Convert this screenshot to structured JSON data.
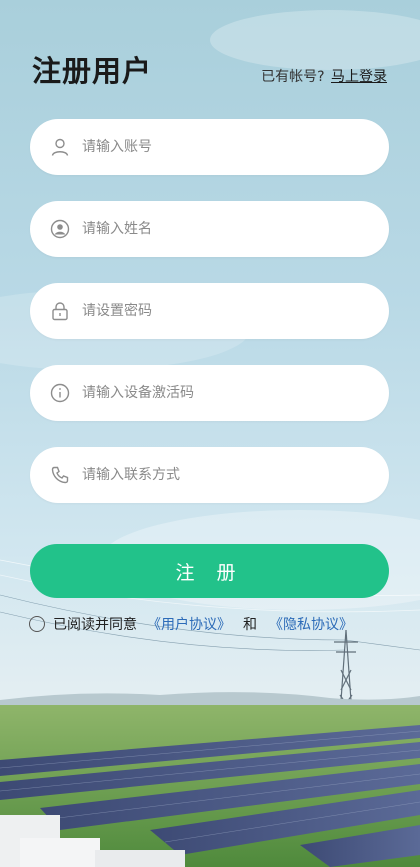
{
  "header": {
    "title": "注册用户",
    "has_account": "已有帐号?",
    "login_link": "马上登录"
  },
  "form": {
    "account_placeholder": "请输入账号",
    "name_placeholder": "请输入姓名",
    "password_placeholder": "请设置密码",
    "activation_placeholder": "请输入设备激活码",
    "contact_placeholder": "请输入联系方式",
    "submit_label": "注 册"
  },
  "agreement": {
    "prefix": "已阅读并同意",
    "user_agreement": "《用户协议》",
    "and": "和",
    "privacy_agreement": "《隐私协议》"
  },
  "icons": {
    "account": "user-icon",
    "name": "person-circle-icon",
    "password": "lock-icon",
    "activation": "info-icon",
    "contact": "phone-icon"
  },
  "colors": {
    "accent": "#22c28a",
    "link": "#2c6bb8"
  }
}
